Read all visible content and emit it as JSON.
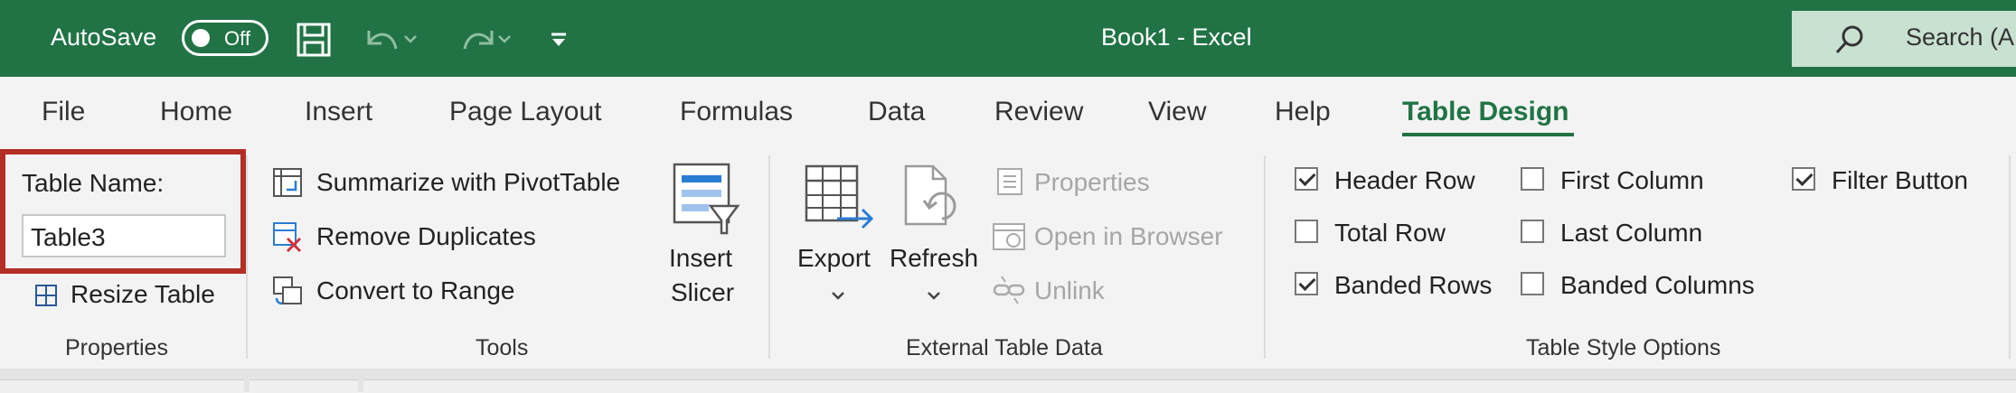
{
  "titlebar": {
    "autosave_label": "AutoSave",
    "autosave_state": "Off",
    "title": "Book1  -  Excel",
    "search_label": "Search (A"
  },
  "tabs": [
    {
      "label": "File"
    },
    {
      "label": "Home"
    },
    {
      "label": "Insert"
    },
    {
      "label": "Page Layout"
    },
    {
      "label": "Formulas"
    },
    {
      "label": "Data"
    },
    {
      "label": "Review"
    },
    {
      "label": "View"
    },
    {
      "label": "Help"
    },
    {
      "label": "Table Design",
      "active": true
    }
  ],
  "properties": {
    "table_name_label": "Table Name:",
    "table_name_value": "Table3",
    "resize_label": "Resize Table",
    "group_label": "Properties"
  },
  "tools": {
    "summarize_label": "Summarize with PivotTable",
    "remove_dup_label": "Remove Duplicates",
    "convert_label": "Convert to Range",
    "insert_slicer_line1": "Insert",
    "insert_slicer_line2": "Slicer",
    "group_label": "Tools"
  },
  "external": {
    "export_label": "Export",
    "refresh_label": "Refresh",
    "properties_label": "Properties",
    "open_browser_label": "Open in Browser",
    "unlink_label": "Unlink",
    "group_label": "External Table Data"
  },
  "style_options": {
    "header_row": {
      "label": "Header Row",
      "checked": true
    },
    "total_row": {
      "label": "Total Row",
      "checked": false
    },
    "banded_rows": {
      "label": "Banded Rows",
      "checked": true
    },
    "first_column": {
      "label": "First Column",
      "checked": false
    },
    "last_column": {
      "label": "Last Column",
      "checked": false
    },
    "banded_columns": {
      "label": "Banded Columns",
      "checked": false
    },
    "filter_button": {
      "label": "Filter Button",
      "checked": true
    },
    "group_label": "Table Style Options"
  },
  "colors": {
    "brand_green": "#217346",
    "highlight_red": "#b22e26"
  }
}
